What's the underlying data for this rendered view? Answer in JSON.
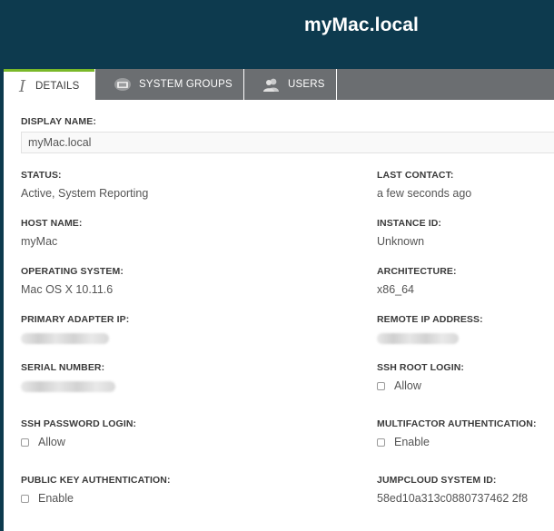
{
  "header": {
    "title": "myMac.local"
  },
  "tabs": [
    {
      "label": "DETAILS",
      "icon": "info-icon"
    },
    {
      "label": "SYSTEM GROUPS",
      "icon": "system-groups-icon"
    },
    {
      "label": "USERS",
      "icon": "users-icon"
    }
  ],
  "details": {
    "display_name_label": "DISPLAY NAME:",
    "display_name_value": "myMac.local",
    "status_label": "STATUS:",
    "status_value": "Active, System Reporting",
    "last_contact_label": "LAST CONTACT:",
    "last_contact_value": "a few seconds ago",
    "host_name_label": "HOST NAME:",
    "host_name_value": "myMac",
    "instance_id_label": "INSTANCE ID:",
    "instance_id_value": "Unknown",
    "os_label": "OPERATING SYSTEM:",
    "os_value": "Mac OS X 10.11.6",
    "arch_label": "ARCHITECTURE:",
    "arch_value": "x86_64",
    "primary_ip_label": "PRIMARY ADAPTER IP:",
    "remote_ip_label": "REMOTE IP ADDRESS:",
    "serial_label": "SERIAL NUMBER:",
    "ssh_root_label": "SSH ROOT LOGIN:",
    "ssh_root_option": "Allow",
    "ssh_password_label": "SSH PASSWORD LOGIN:",
    "ssh_password_option": "Allow",
    "mfa_label": "MULTIFACTOR AUTHENTICATION:",
    "mfa_option": "Enable",
    "pubkey_label": "PUBLIC KEY AUTHENTICATION:",
    "pubkey_option": "Enable",
    "system_id_label": "JUMPCLOUD SYSTEM ID:",
    "system_id_value": "58ed10a313c0880737462 2f8"
  },
  "colors": {
    "header_bg": "#0d3a4e",
    "tab_bar_bg": "#6b6e71",
    "active_tab_accent": "#7ab829"
  }
}
